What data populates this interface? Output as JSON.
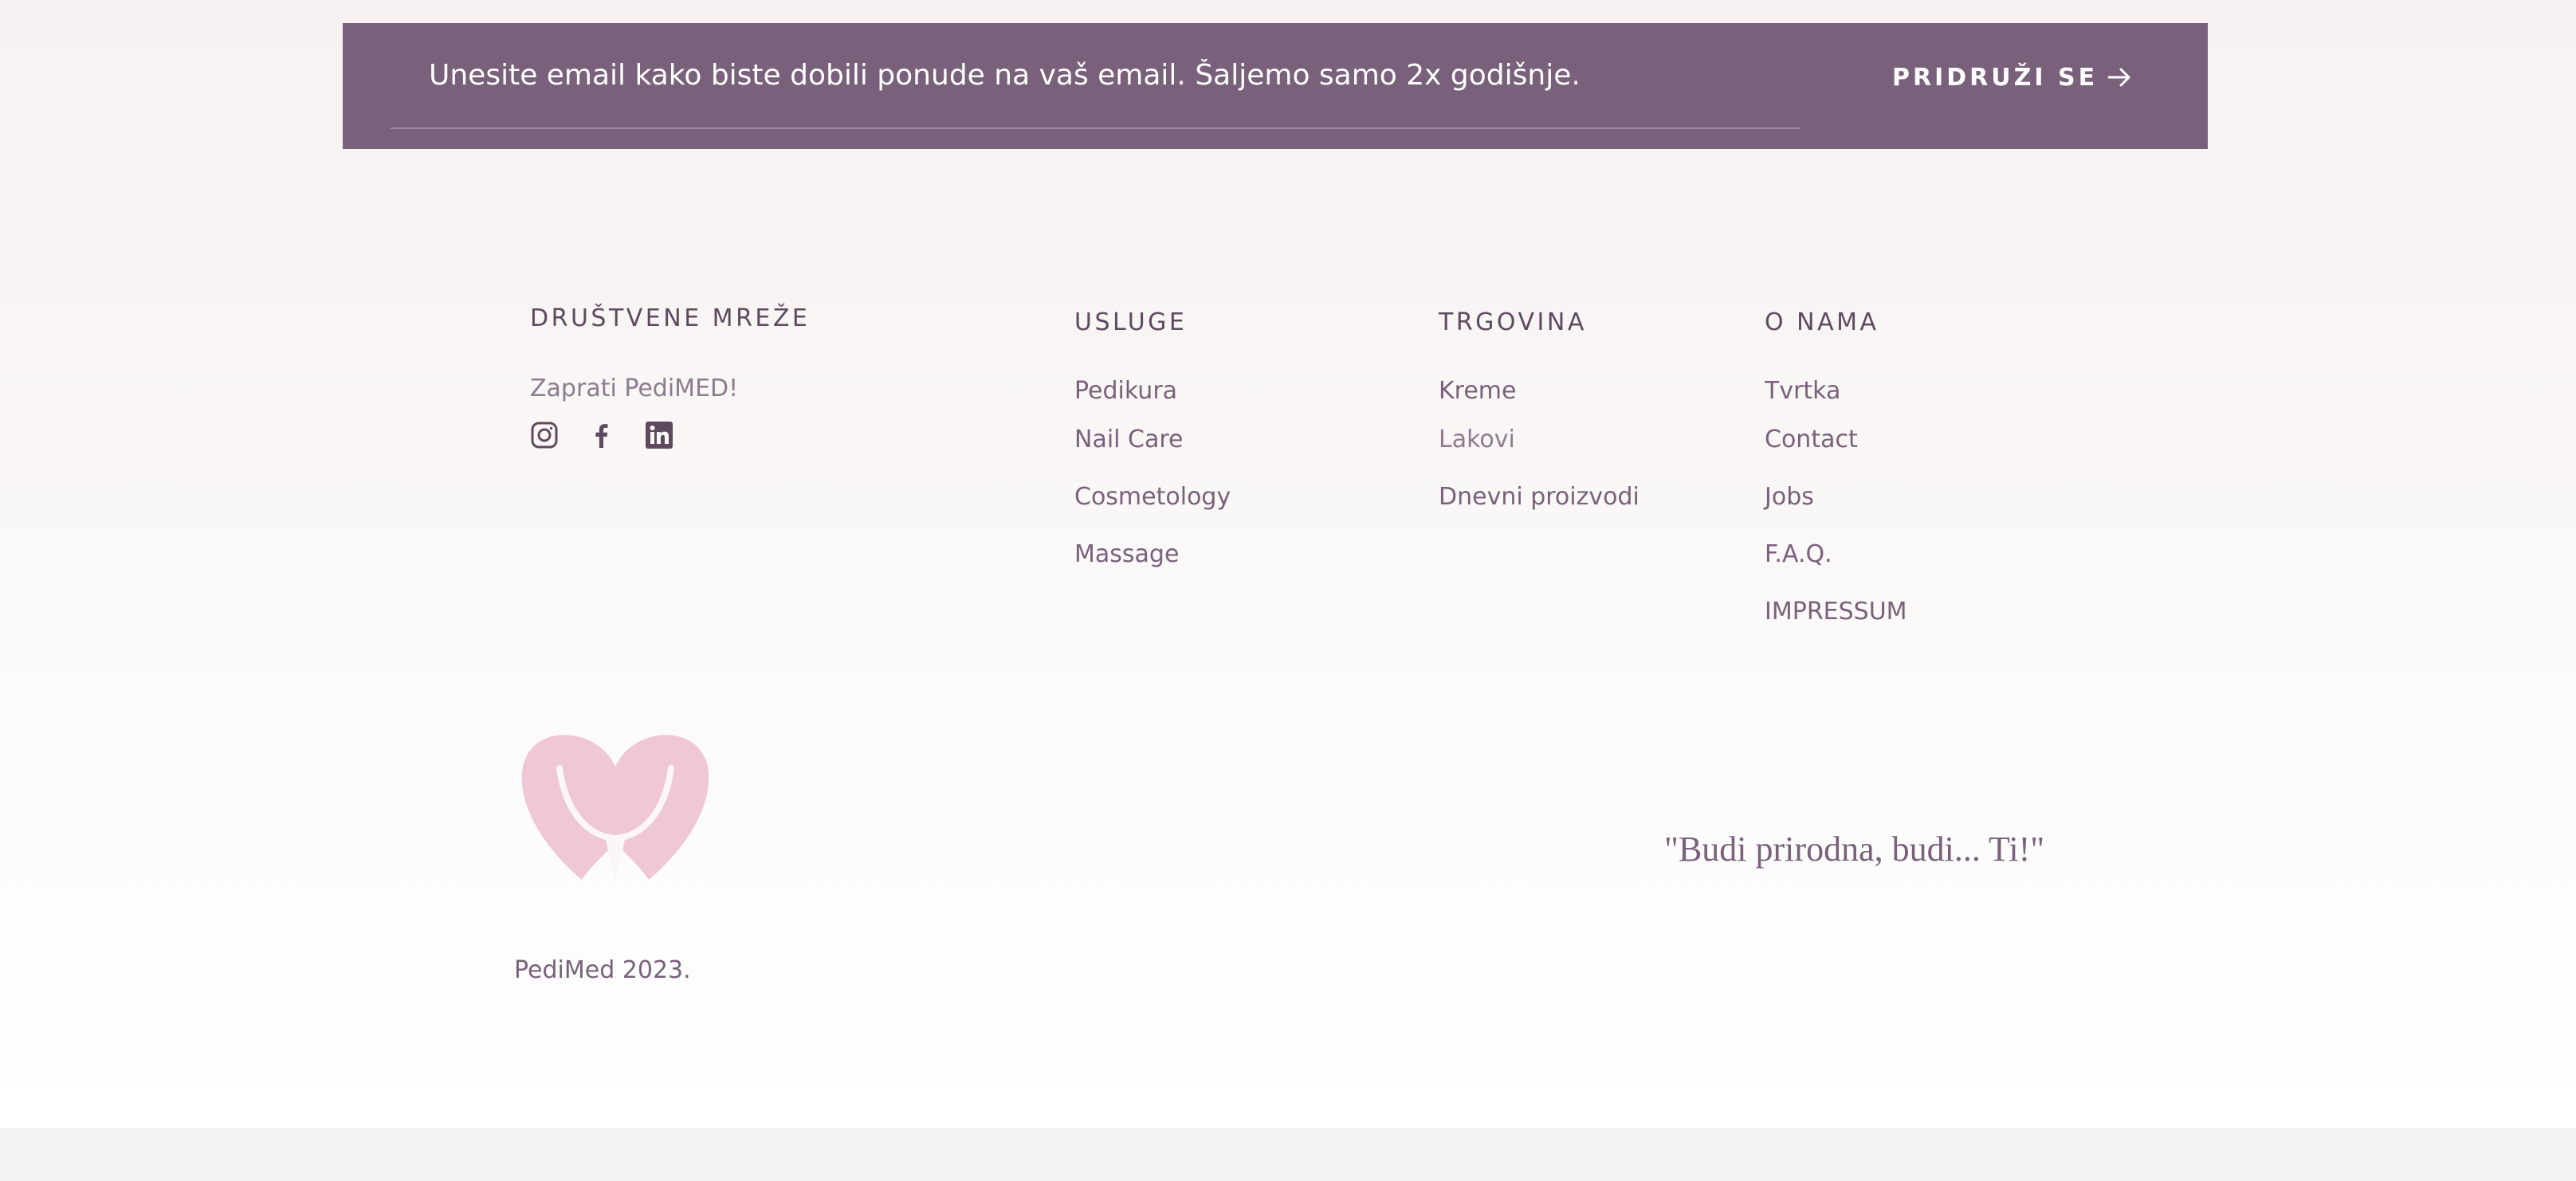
{
  "newsletter": {
    "placeholder": "Unesite email kako biste dobili ponude na vaš email. Šaljemo samo 2x godišnje.",
    "button_label": "PRIDRUŽI SE"
  },
  "social": {
    "heading": "DRUŠTVENE MREŽE",
    "follow_text": "Zaprati PediMED!",
    "icons": [
      "instagram-icon",
      "facebook-icon",
      "linkedin-icon"
    ]
  },
  "services": {
    "heading": "USLUGE",
    "items": [
      "Pedikura",
      "Nail Care",
      "Cosmetology",
      "Massage"
    ]
  },
  "shop": {
    "heading": "TRGOVINA",
    "items": [
      "Kreme",
      "Lakovi",
      "Dnevni proizvodi"
    ]
  },
  "about": {
    "heading": "O NAMA",
    "items": [
      "Tvrtka",
      "Contact",
      "Jobs",
      "F.A.Q.",
      "IMPRESSUM"
    ]
  },
  "tagline": "\"Budi prirodna, budi... Ti!\"",
  "copyright": "PediMed 2023.",
  "colors": {
    "newsletter_bg": "#79617b",
    "text_primary": "#79617b",
    "heading": "#5e4a5f",
    "logo_pink": "#efc7d7"
  }
}
